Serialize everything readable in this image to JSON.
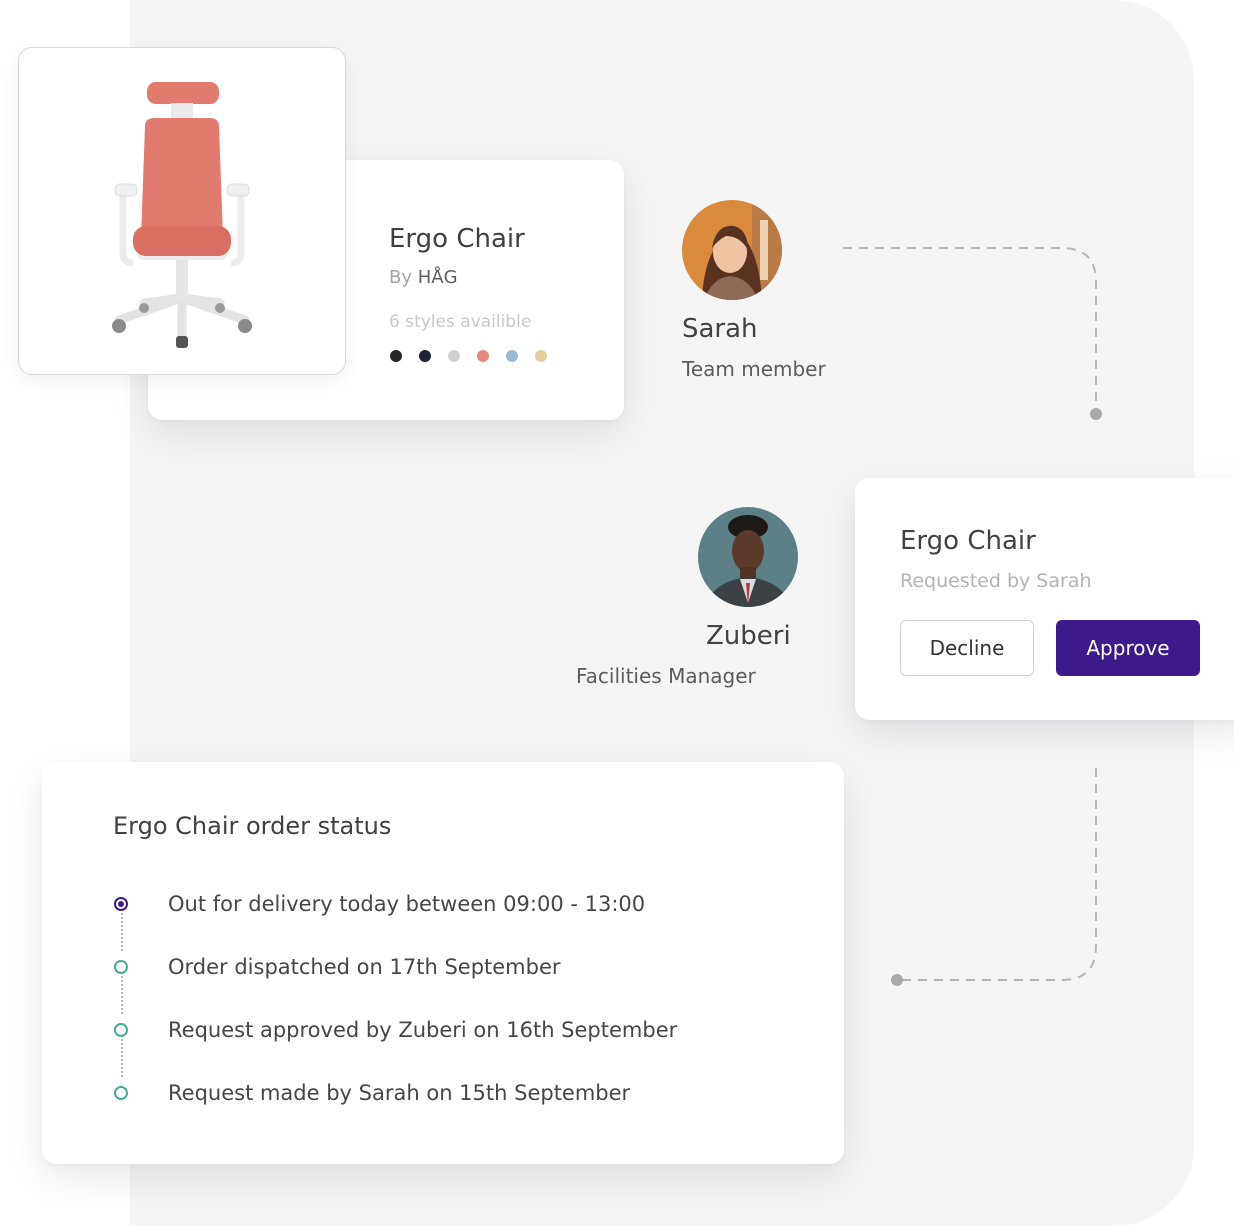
{
  "product": {
    "title": "Ergo Chair",
    "brand_prefix": "By",
    "brand": "HÅG",
    "styles_text": "6 styles availible",
    "swatch_colors": [
      "#262626",
      "#1e2433",
      "#cfcfcf",
      "#e58a7e",
      "#9db8d2",
      "#e3cf9a"
    ]
  },
  "people": {
    "requester": {
      "name": "Sarah",
      "role": "Team member"
    },
    "approver": {
      "name": "Zuberi",
      "role": "Facilities Manager"
    }
  },
  "approval": {
    "title": "Ergo Chair",
    "subtitle": "Requested by Sarah",
    "decline_label": "Decline",
    "approve_label": "Approve"
  },
  "order_status": {
    "title": "Ergo Chair order status",
    "steps": [
      {
        "text": "Out for delivery today between 09:00 - 13:00",
        "active": true
      },
      {
        "text": "Order dispatched on 17th September",
        "active": false
      },
      {
        "text": "Request approved by Zuberi on 16th September",
        "active": false
      },
      {
        "text": "Request made by Sarah on 15th September",
        "active": false
      }
    ]
  },
  "colors": {
    "brand": "#3c1a8a",
    "timeline_done": "#4aa89a",
    "chair": "#e07b6e"
  }
}
